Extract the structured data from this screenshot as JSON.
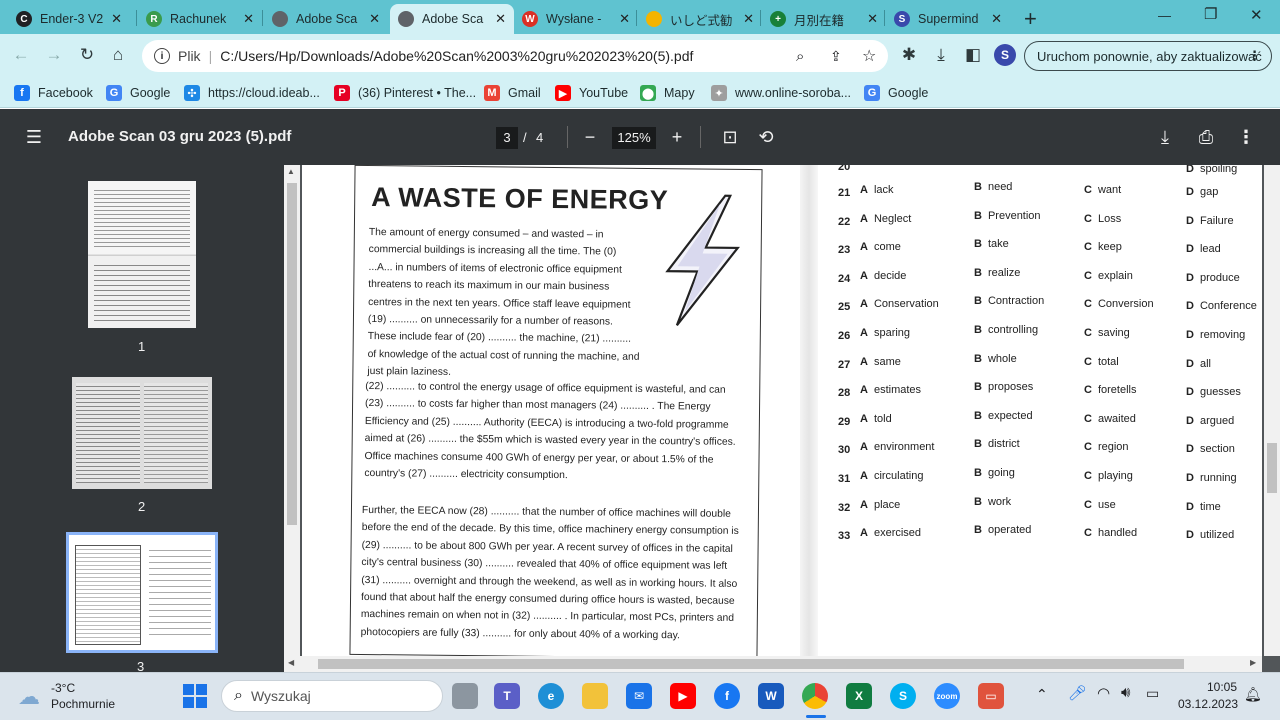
{
  "tabs": [
    {
      "title": "Ender-3 V2",
      "color": "#202124",
      "glyph": "C"
    },
    {
      "title": "Rachunek",
      "color": "#3a9b4c",
      "glyph": "R"
    },
    {
      "title": "Adobe Sca",
      "color": "#5f6368",
      "glyph": ""
    },
    {
      "title": "Adobe Sca",
      "color": "#5f6368",
      "glyph": ""
    },
    {
      "title": "Wysłane -",
      "color": "#d93025",
      "glyph": "W"
    },
    {
      "title": "いしど式勧",
      "color": "#f4b400",
      "glyph": ""
    },
    {
      "title": "月別在籍",
      "color": "#188038",
      "glyph": "+"
    },
    {
      "title": "Supermind",
      "color": "#3949ab",
      "glyph": "S"
    }
  ],
  "new_tab": "+",
  "window_controls": {
    "minimize": "—",
    "restore": "❐",
    "close": "✕"
  },
  "omnibox": {
    "label": "Plik",
    "url": "C:/Users/Hp/Downloads/Adobe%20Scan%2003%20gru%202023%20(5).pdf"
  },
  "update_button": "Uruchom ponownie, aby zaktualizować",
  "bookmarks": [
    {
      "label": "Facebook",
      "color": "#1877f2",
      "glyph": "f"
    },
    {
      "label": "Google",
      "color": "#4285f4",
      "glyph": "G"
    },
    {
      "label": "https://cloud.ideab...",
      "color": "#1e88e5",
      "glyph": "✣"
    },
    {
      "label": "(36) Pinterest • The...",
      "color": "#e60023",
      "glyph": "P"
    },
    {
      "label": "Gmail",
      "color": "#ea4335",
      "glyph": "M"
    },
    {
      "label": "YouTube",
      "color": "#ff0000",
      "glyph": "▶"
    },
    {
      "label": "Mapy",
      "color": "#34a853",
      "glyph": "⬤"
    },
    {
      "label": "www.online-soroba...",
      "color": "#9e9e9e",
      "glyph": "✦"
    },
    {
      "label": "Google",
      "color": "#4285f4",
      "glyph": "G"
    }
  ],
  "pdf": {
    "title": "Adobe Scan 03 gru 2023 (5).pdf",
    "page_current": "3",
    "page_sep": "/",
    "page_total": "4",
    "zoom": "125%",
    "thumbs": [
      "1",
      "2",
      "3"
    ]
  },
  "article": {
    "title": "A WASTE OF ENERGY",
    "p1": "The amount of energy consumed – and wasted – in commercial buildings is increasing all the time. The (0) ...A... in numbers of items of electronic office equipment threatens to reach its maximum in our main business centres in the next ten years. Office staff leave equipment (19) .......... on unnecessarily for a number of reasons. These include fear of (20) .......... the machine, (21) .......... of knowledge of the actual cost of running the machine, and just plain laziness.",
    "p2": "(22) .......... to control the energy usage of office equipment is wasteful, and can (23) .......... to costs far higher than most managers (24) .......... . The Energy Efficiency and (25) .......... Authority (EECA) is introducing a two-fold programme aimed at (26) .......... the $55m which is wasted every year in the country's offices. Office machines consume 400 GWh of energy per year, or about 1.5% of the country's (27) .......... electricity consumption.",
    "p3": "Further, the EECA now (28) .......... that the number of office machines will double before the end of the decade. By this time, office machinery energy consumption is (29) .......... to be about 800 GWh per year. A recent survey of offices in the capital city's central business (30) .......... revealed that 40% of office equipment was left (31) .......... overnight and through the weekend, as well as in working hours. It also found that about half the energy consumed during office hours is wasted, because machines remain on when not in (32) .......... . In particular, most PCs, printers and photocopiers are fully (33) .......... for only about 40% of a working day."
  },
  "answers": [
    {
      "n": "21",
      "a": "lack",
      "b": "need",
      "c": "want",
      "d": "gap"
    },
    {
      "n": "22",
      "a": "Neglect",
      "b": "Prevention",
      "c": "Loss",
      "d": "Failure"
    },
    {
      "n": "23",
      "a": "come",
      "b": "take",
      "c": "keep",
      "d": "lead"
    },
    {
      "n": "24",
      "a": "decide",
      "b": "realize",
      "c": "explain",
      "d": "produce"
    },
    {
      "n": "25",
      "a": "Conservation",
      "b": "Contraction",
      "c": "Conversion",
      "d": "Conference"
    },
    {
      "n": "26",
      "a": "sparing",
      "b": "controlling",
      "c": "saving",
      "d": "removing"
    },
    {
      "n": "27",
      "a": "same",
      "b": "whole",
      "c": "total",
      "d": "all"
    },
    {
      "n": "28",
      "a": "estimates",
      "b": "proposes",
      "c": "foretells",
      "d": "guesses"
    },
    {
      "n": "29",
      "a": "told",
      "b": "expected",
      "c": "awaited",
      "d": "argued"
    },
    {
      "n": "30",
      "a": "environment",
      "b": "district",
      "c": "region",
      "d": "section"
    },
    {
      "n": "31",
      "a": "circulating",
      "b": "going",
      "c": "playing",
      "d": "running"
    },
    {
      "n": "32",
      "a": "place",
      "b": "work",
      "c": "use",
      "d": "time"
    },
    {
      "n": "33",
      "a": "exercised",
      "b": "operated",
      "c": "handled",
      "d": "utilized"
    }
  ],
  "answers_top": {
    "n": "20",
    "d": "spoiling"
  },
  "letters": {
    "a": "A",
    "b": "B",
    "c": "C",
    "d": "D"
  },
  "taskbar": {
    "weather_temp": "-3°C",
    "weather_desc": "Pochmurnie",
    "search_placeholder": "Wyszukaj",
    "time": "10:05",
    "date": "03.12.2023"
  }
}
